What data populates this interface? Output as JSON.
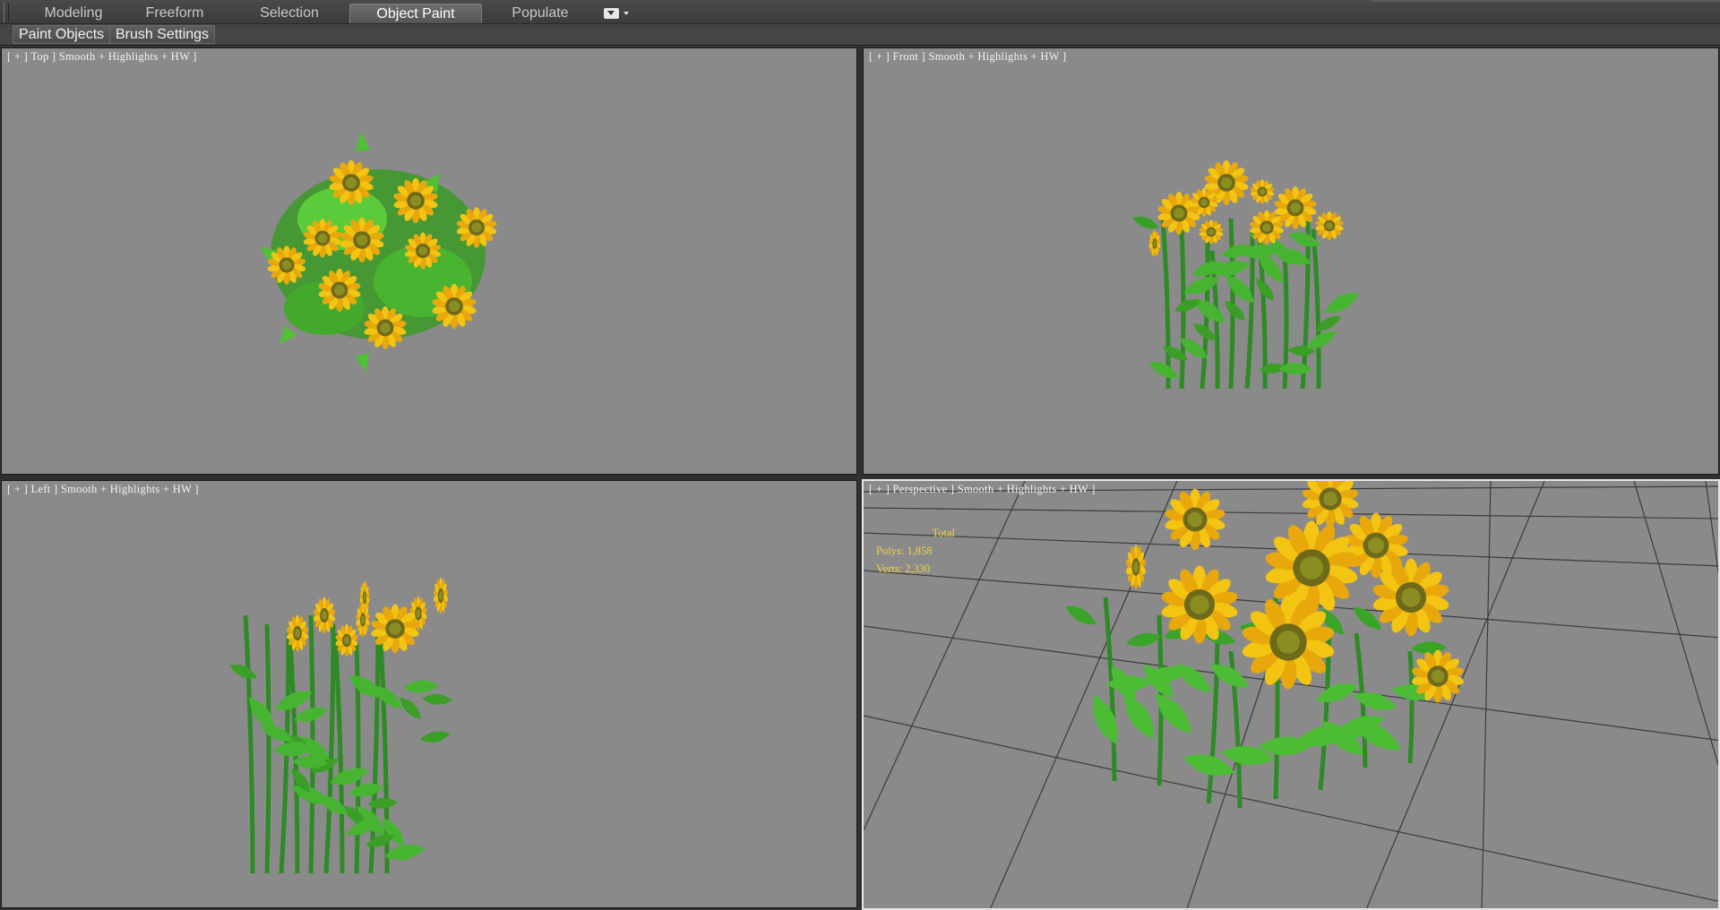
{
  "ribbon": {
    "tabs": [
      {
        "label": "Modeling",
        "active": false
      },
      {
        "label": "Freeform",
        "active": false
      },
      {
        "label": "Selection",
        "active": false
      },
      {
        "label": "Object Paint",
        "active": true
      },
      {
        "label": "Populate",
        "active": false
      }
    ],
    "extra_icon": "display-options-icon",
    "panel_buttons": [
      {
        "label": "Paint Objects"
      },
      {
        "label": "Brush Settings"
      }
    ]
  },
  "viewports": {
    "top": {
      "label": "[ + ] Top ] Smooth + Highlights + HW ]"
    },
    "front": {
      "label": "[ + ] Front ] Smooth + Highlights + HW ]"
    },
    "left": {
      "label": "[ + ] Left ] Smooth + Highlights + HW ]"
    },
    "perspective": {
      "label": "[ + ] Perspective ] Smooth + Highlights + HW ]",
      "stats": {
        "total_label": "Total",
        "polys": "Polys: 1,858",
        "verts": "Verts: 2,330"
      }
    }
  },
  "colors": {
    "viewport_bg": "#8a8a8a",
    "grid_line": "#3c3c3c",
    "stats_text": "#f5d23c",
    "petal": "#f3c411",
    "flower_center": "#6f6a1a",
    "leaf": "#3fae2a",
    "stem": "#2e8a24"
  }
}
